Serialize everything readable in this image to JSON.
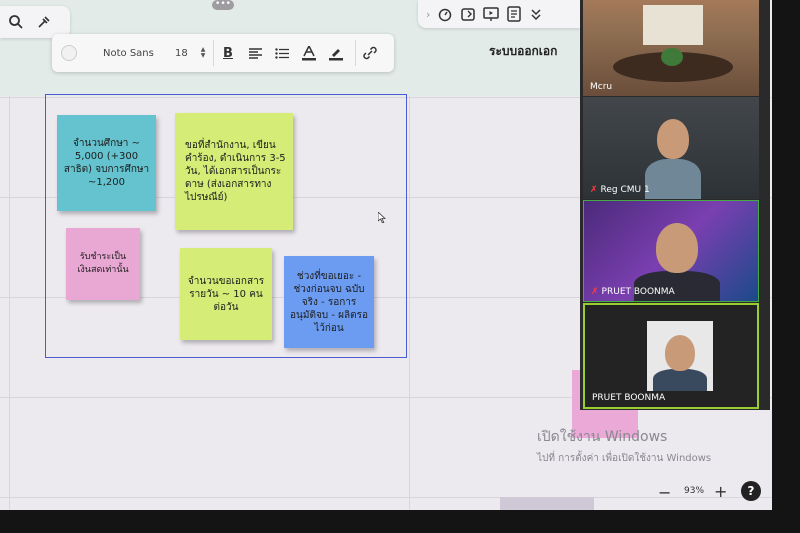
{
  "toolbar": {
    "font_name": "Noto Sans",
    "font_size": "18",
    "tools": [
      "bold-icon",
      "align-icon",
      "list-icon",
      "text-color-icon",
      "highlight-icon",
      "link-icon"
    ]
  },
  "right_toolbar": {
    "icons": [
      "chevron-right-icon",
      "timer-icon",
      "export-icon",
      "present-icon",
      "notes-icon",
      "collapse-icon"
    ]
  },
  "board": {
    "title": "ระบบออกเอก",
    "notes": [
      "จำนวนศึกษา ~ 5,000 (+300 สาธิต) จบการศึกษา ~1,200",
      "ขอที่สำนักงาน, เขียนคำร้อง, ดำเนินการ 3-5 วัน, ได้เอกสารเป็นกระดาษ (ส่งเอกสารทางไปรษณีย์)",
      "รับชำระเป็นเงินสดเท่านั้น",
      "จำนวนขอเอกสารรายวัน ~ 10 คนต่อวัน",
      "ช่วงที่ขอเยอะ - ช่วงก่อนจบ ฉบับจริง - รอการอนุมัติจบ - ผลิตรอไว้ก่อน"
    ]
  },
  "activation": {
    "line1": "เปิดใช้งาน Windows",
    "line2": "ไปที่ การตั้งค่า เพื่อเปิดใช้งาน Windows"
  },
  "zoom": {
    "minus": "−",
    "level": "93%",
    "plus": "+",
    "help": "?"
  },
  "participants": [
    {
      "name": "Mcru",
      "muted": false
    },
    {
      "name": "Reg CMU 1",
      "muted": true
    },
    {
      "name": "PRUET BOONMA",
      "muted": true
    },
    {
      "name": "PRUET BOONMA",
      "muted": false
    }
  ]
}
